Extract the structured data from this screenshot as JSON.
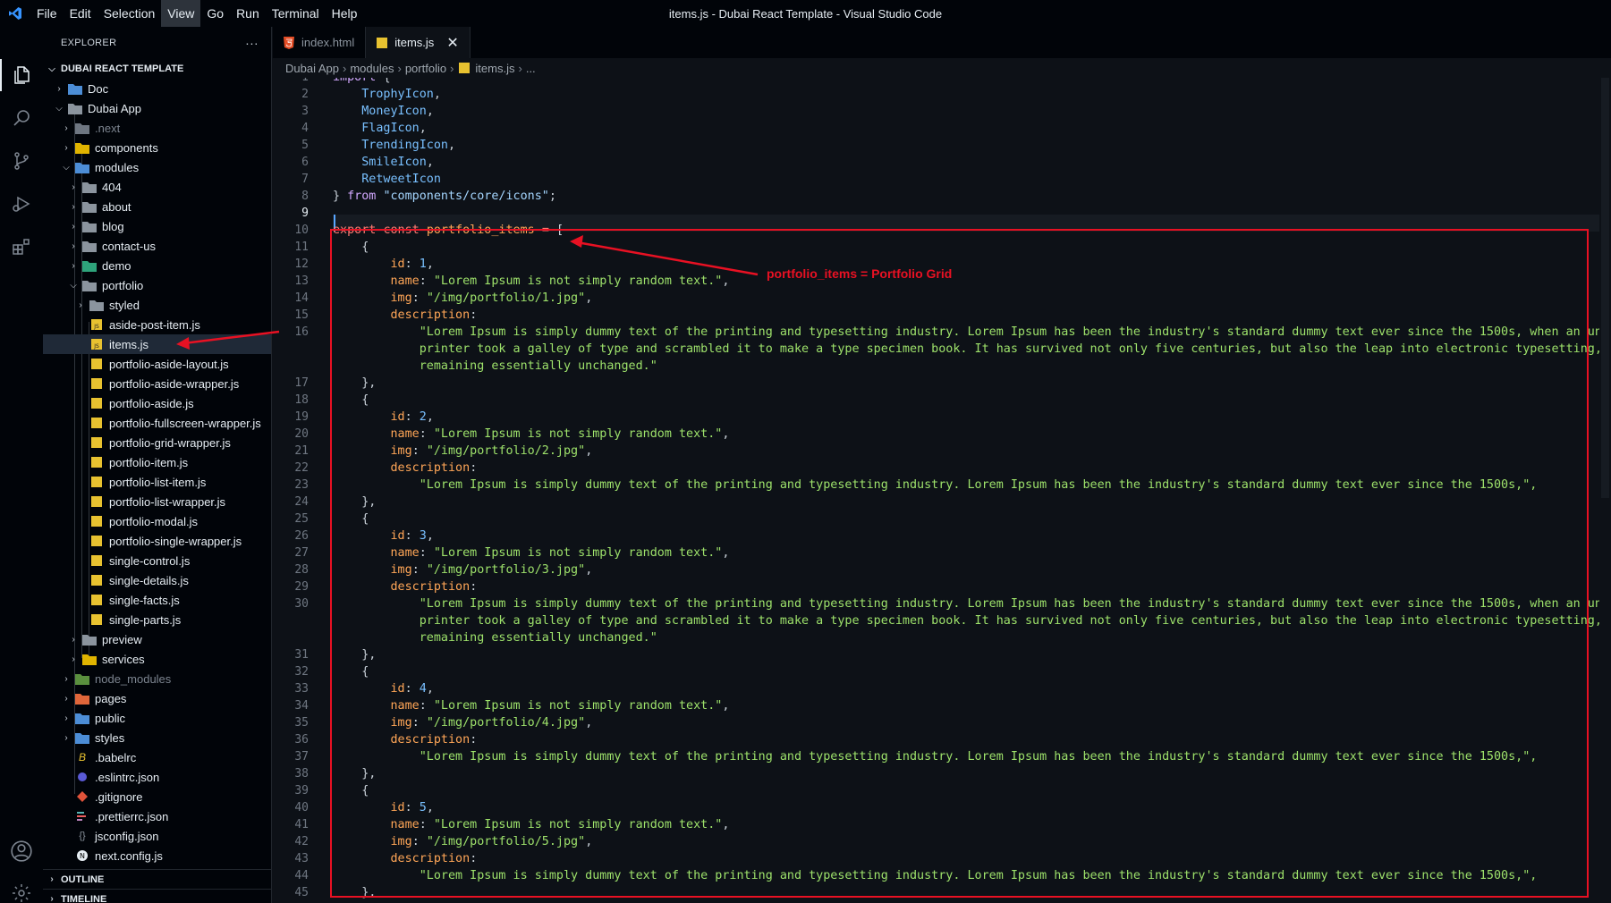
{
  "menu": [
    "File",
    "Edit",
    "Selection",
    "View",
    "Go",
    "Run",
    "Terminal",
    "Help"
  ],
  "window_title": "items.js - Dubai React Template - Visual Studio Code",
  "explorer": {
    "title": "EXPLORER",
    "more": "···",
    "root": "DUBAI REACT TEMPLATE",
    "items": [
      "Doc",
      "Dubai App",
      ".next",
      "components",
      "modules",
      "404",
      "about",
      "blog",
      "contact-us",
      "demo",
      "portfolio",
      "styled",
      "aside-post-item.js",
      "items.js",
      "portfolio-aside-layout.js",
      "portfolio-aside-wrapper.js",
      "portfolio-aside.js",
      "portfolio-fullscreen-wrapper.js",
      "portfolio-grid-wrapper.js",
      "portfolio-item.js",
      "portfolio-list-item.js",
      "portfolio-list-wrapper.js",
      "portfolio-modal.js",
      "portfolio-single-wrapper.js",
      "single-control.js",
      "single-details.js",
      "single-facts.js",
      "single-parts.js",
      "preview",
      "services",
      "node_modules",
      "pages",
      "public",
      "styles",
      ".babelrc",
      ".eslintrc.json",
      ".gitignore",
      ".prettierrc.json",
      "jsconfig.json",
      "next.config.js"
    ],
    "outline": "OUTLINE",
    "timeline": "TIMELINE"
  },
  "tabs": [
    {
      "label": "index.html"
    },
    {
      "label": "items.js",
      "close": "✕"
    }
  ],
  "breadcrumb": [
    "Dubai App",
    "modules",
    "portfolio",
    "items.js",
    "..."
  ],
  "line_numbers": [
    "1",
    "2",
    "3",
    "4",
    "5",
    "6",
    "7",
    "8",
    "9",
    "10",
    "11",
    "12",
    "13",
    "14",
    "15",
    "16",
    "17",
    "18",
    "19",
    "20",
    "21",
    "22",
    "23",
    "24",
    "25",
    "26",
    "27",
    "28",
    "29",
    "30",
    "31",
    "32",
    "33",
    "34",
    "35",
    "36",
    "37",
    "38",
    "39",
    "40",
    "41",
    "42",
    "43",
    "44",
    "45"
  ],
  "code": {
    "import_kw": "import",
    "icons": [
      "TrophyIcon",
      "MoneyIcon",
      "FlagIcon",
      "TrendingIcon",
      "SmileIcon",
      "RetweetIcon"
    ],
    "from_kw": "from",
    "import_path": "\"components/core/icons\"",
    "export_kw": "export",
    "const_kw": "const",
    "var_name": "portfolio_items",
    "items": [
      {
        "id": "1",
        "name": "\"Lorem Ipsum is not simply random text.\"",
        "img": "\"/img/portfolio/1.jpg\"",
        "desc": [
          "\"Lorem Ipsum is simply dummy text of the printing and typesetting industry. Lorem Ipsum has been the industry's standard dummy text ever since the 1500s, when an unknown",
          "printer took a galley of type and scrambled it to make a type specimen book. It has survived not only five centuries, but also the leap into electronic typesetting,",
          "remaining essentially unchanged.\""
        ]
      },
      {
        "id": "2",
        "name": "\"Lorem Ipsum is not simply random text.\"",
        "img": "\"/img/portfolio/2.jpg\"",
        "desc": [
          "\"Lorem Ipsum is simply dummy text of the printing and typesetting industry. Lorem Ipsum has been the industry's standard dummy text ever since the 1500s,\","
        ]
      },
      {
        "id": "3",
        "name": "\"Lorem Ipsum is not simply random text.\"",
        "img": "\"/img/portfolio/3.jpg\"",
        "desc": [
          "\"Lorem Ipsum is simply dummy text of the printing and typesetting industry. Lorem Ipsum has been the industry's standard dummy text ever since the 1500s, when an unknown",
          "printer took a galley of type and scrambled it to make a type specimen book. It has survived not only five centuries, but also the leap into electronic typesetting,",
          "remaining essentially unchanged.\""
        ]
      },
      {
        "id": "4",
        "name": "\"Lorem Ipsum is not simply random text.\"",
        "img": "\"/img/portfolio/4.jpg\"",
        "desc": [
          "\"Lorem Ipsum is simply dummy text of the printing and typesetting industry. Lorem Ipsum has been the industry's standard dummy text ever since the 1500s,\","
        ]
      },
      {
        "id": "5",
        "name": "\"Lorem Ipsum is not simply random text.\"",
        "img": "\"/img/portfolio/5.jpg\"",
        "desc": [
          "\"Lorem Ipsum is simply dummy text of the printing and typesetting industry. Lorem Ipsum has been the industry's standard dummy text ever since the 1500s,\","
        ]
      }
    ]
  },
  "annotation": "portfolio_items = Portfolio Grid",
  "colors": {
    "accent": "#e81123",
    "background": "#0d1117"
  }
}
